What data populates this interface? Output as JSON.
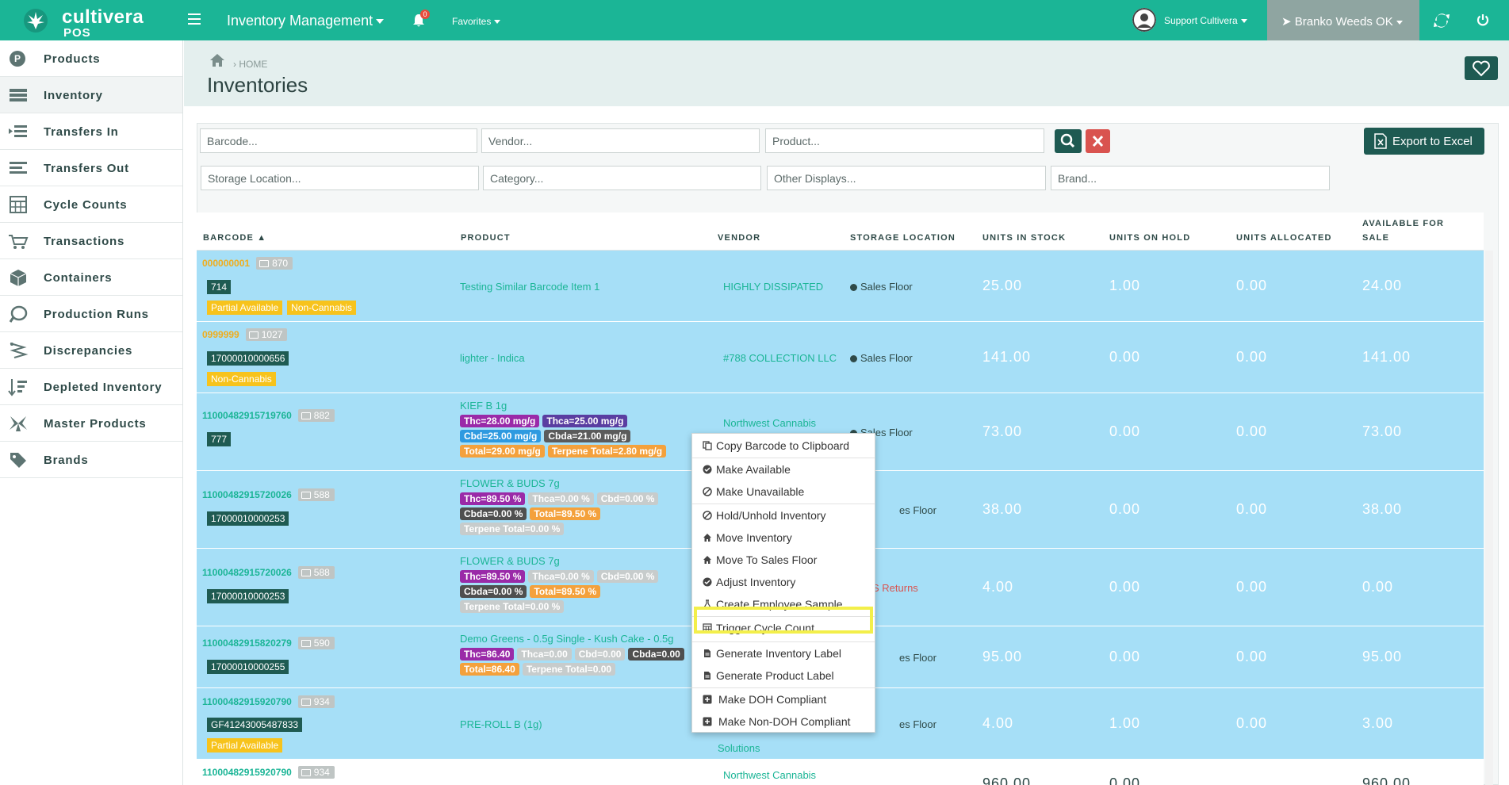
{
  "topbar": {
    "brand_name": "cultivera",
    "brand_sub": "POS",
    "menu_title": "Inventory Management",
    "notification_count": "0",
    "favorites": "Favorites",
    "user": "Support Cultivera",
    "location": "Branko Weeds OK"
  },
  "sidebar": {
    "items": [
      {
        "label": "Products",
        "icon": "products-icon"
      },
      {
        "label": "Inventory",
        "icon": "inventory-icon"
      },
      {
        "label": "Transfers In",
        "icon": "transfers-in-icon"
      },
      {
        "label": "Transfers Out",
        "icon": "transfers-out-icon"
      },
      {
        "label": "Cycle Counts",
        "icon": "cycle-counts-icon"
      },
      {
        "label": "Transactions",
        "icon": "transactions-icon"
      },
      {
        "label": "Containers",
        "icon": "containers-icon"
      },
      {
        "label": "Production Runs",
        "icon": "production-runs-icon"
      },
      {
        "label": "Discrepancies",
        "icon": "discrepancies-icon"
      },
      {
        "label": "Depleted Inventory",
        "icon": "depleted-inventory-icon"
      },
      {
        "label": "Master Products",
        "icon": "master-products-icon"
      },
      {
        "label": "Brands",
        "icon": "brands-icon"
      }
    ]
  },
  "header": {
    "breadcrumb": "› HOME",
    "title": "Inventories"
  },
  "filters": {
    "barcode": "Barcode...",
    "vendor": "Vendor...",
    "product": "Product...",
    "storage_location": "Storage Location...",
    "category": "Category...",
    "other_displays": "Other Displays...",
    "brand": "Brand...",
    "export_label": "Export to Excel"
  },
  "table": {
    "headers": {
      "barcode": "BARCODE ▲",
      "product": "PRODUCT",
      "vendor": "VENDOR",
      "storage_location": "STORAGE LOCATION",
      "units_in_stock": "UNITS IN STOCK",
      "units_on_hold": "UNITS ON HOLD",
      "units_allocated": "UNITS ALLOCATED",
      "available_1": "AVAILABLE FOR",
      "available_2": "SALE"
    },
    "rows": [
      {
        "barcode": "000000001",
        "qty": "870",
        "tag": "714",
        "flags": [
          "Partial Available",
          "Non-Cannabis"
        ],
        "product": "Testing Similar Barcode Item 1",
        "vendor": "HIGHLY DISSIPATED",
        "location": "Sales Floor",
        "in_stock": "25.00",
        "on_hold": "1.00",
        "allocated": "0.00",
        "available": "24.00"
      },
      {
        "barcode": "0999999",
        "qty": "1027",
        "tag": "17000010000656",
        "flags": [
          "Non-Cannabis"
        ],
        "product": "lighter - Indica",
        "vendor": "#788 COLLECTION LLC",
        "location": "Sales Floor",
        "in_stock": "141.00",
        "on_hold": "0.00",
        "allocated": "0.00",
        "available": "141.00"
      },
      {
        "barcode": "11000482915719760",
        "qty": "882",
        "tag": "777",
        "product": "KIEF B 1g",
        "pills": [
          "Thc=28.00 mg/g",
          "Thca=25.00 mg/g",
          "Cbd=25.00 mg/g",
          "Cbda=21.00 mg/g",
          "Total=29.00 mg/g",
          "Terpene Total=2.80 mg/g"
        ],
        "vendor": "Northwest Cannabis",
        "location": "Sales Floor",
        "in_stock": "73.00",
        "on_hold": "0.00",
        "allocated": "0.00",
        "available": "73.00"
      },
      {
        "barcode": "11000482915720026",
        "qty": "588",
        "tag": "17000010000253",
        "product": "FLOWER & BUDS 7g",
        "pills": [
          "Thc=89.50 %",
          "Thca=0.00 %",
          "Cbd=0.00 %",
          "Cbda=0.00 %",
          "Total=89.50 %",
          "Terpene Total=0.00 %"
        ],
        "location_suffix": "es Floor",
        "in_stock": "38.00",
        "on_hold": "0.00",
        "allocated": "0.00",
        "available": "38.00"
      },
      {
        "barcode": "11000482915720026",
        "qty": "588",
        "tag": "17000010000253",
        "product": "FLOWER & BUDS 7g",
        "pills": [
          "Thc=89.50 %",
          "Thca=0.00 %",
          "Cbd=0.00 %",
          "Cbda=0.00 %",
          "Total=89.50 %",
          "Terpene Total=0.00 %"
        ],
        "location_suffix": "S Returns",
        "in_stock": "4.00",
        "on_hold": "0.00",
        "allocated": "0.00",
        "available": "0.00"
      },
      {
        "barcode": "11000482915820279",
        "qty": "590",
        "tag": "17000010000255",
        "product": "Demo Greens - 0.5g Single - Kush Cake - 0.5g",
        "pills": [
          "Thc=86.40",
          "Thca=0.00",
          "Cbd=0.00",
          "Cbda=0.00",
          "Total=86.40",
          "Terpene Total=0.00"
        ],
        "location_suffix": "es Floor",
        "in_stock": "95.00",
        "on_hold": "0.00",
        "allocated": "0.00",
        "available": "95.00"
      },
      {
        "barcode": "11000482915920790",
        "qty": "934",
        "tag": "GF41243005487833",
        "flags": [
          "Partial Available"
        ],
        "product": "PRE-ROLL B (1g)",
        "vendor_suffix": "Solutions",
        "location_suffix": "es Floor",
        "in_stock": "4.00",
        "on_hold": "1.00",
        "allocated": "0.00",
        "available": "3.00"
      },
      {
        "barcode": "11000482915920790",
        "qty": "934",
        "vendor": "Northwest Cannabis",
        "in_stock": "960.00",
        "on_hold": "0.00",
        "available": "960.00"
      }
    ]
  },
  "context_menu": {
    "items": [
      "Copy Barcode to Clipboard",
      "Make Available",
      "Make Unavailable",
      "Hold/Unhold Inventory",
      "Move Inventory",
      "Move To Sales Floor",
      "Adjust Inventory",
      "Create Employee Sample",
      "Trigger Cycle Count",
      "Generate Inventory Label",
      "Generate Product Label",
      "Make DOH Compliant",
      "Make Non-DOH Compliant"
    ],
    "highlighted": "Trigger Cycle Count"
  },
  "colors": {
    "brand": "#1bb596",
    "dark_teal": "#1e5a52",
    "row_blue": "#a6dff7"
  }
}
